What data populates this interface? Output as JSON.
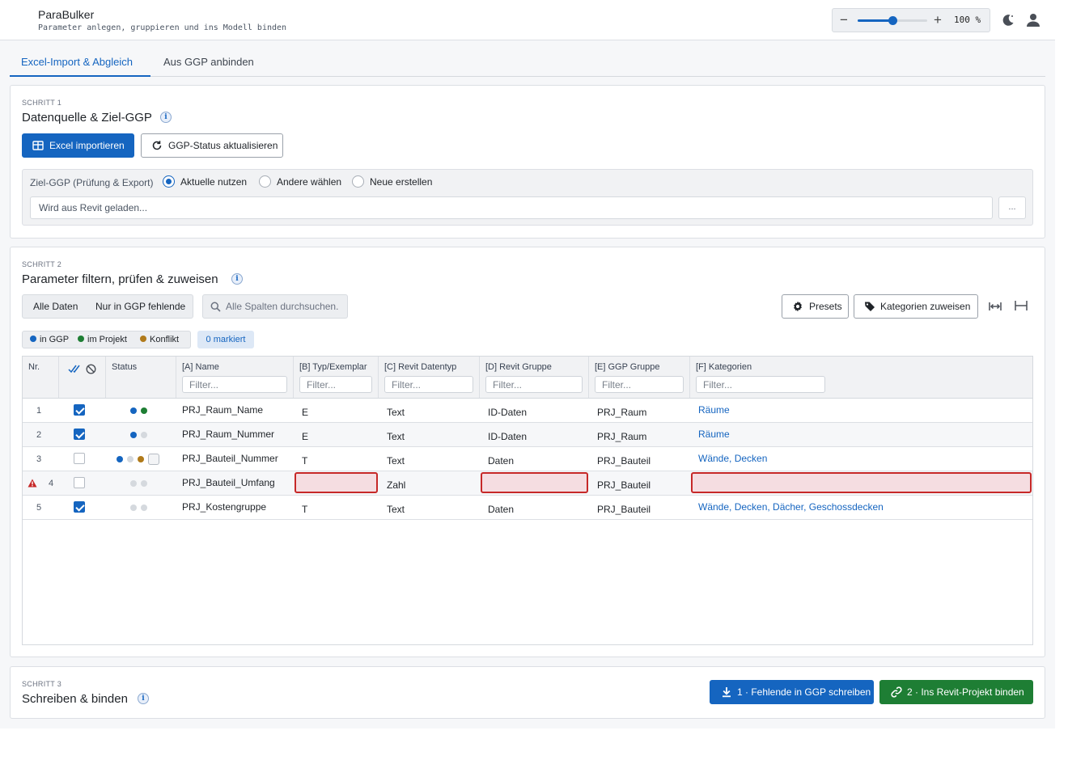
{
  "app": {
    "title": "ParaBulker",
    "subtitle": "Parameter anlegen, gruppieren und ins Modell binden",
    "zoom_label": "100 %",
    "zoom_level_percent": 100,
    "icons": {
      "theme": "moon-icon",
      "user": "user-icon"
    }
  },
  "tabs": [
    {
      "label": "Excel-Import & Abgleich",
      "active": true
    },
    {
      "label": "Aus GGP anbinden",
      "active": false
    }
  ],
  "step1": {
    "label": "SCHRITT 1",
    "title": "Datenquelle & Ziel-GGP",
    "import_button": "Excel importieren",
    "refresh_button": "GGP-Status aktualisieren",
    "target_label": "Ziel-GGP (Prüfung & Export)",
    "radio_options": [
      "Aktuelle nutzen",
      "Andere wählen",
      "Neue erstellen"
    ],
    "selected_option": "Aktuelle nutzen",
    "path_placeholder": "Wird aus Revit geladen...",
    "browse_button": "..."
  },
  "step2": {
    "label": "SCHRITT 2",
    "title": "Parameter filtern, prüfen & zuweisen",
    "filter_all": "Alle Daten",
    "filter_missing": "Nur in GGP fehlende",
    "search_placeholder": "Alle Spalten durchsuchen.",
    "presets_button": "Presets",
    "assign_button": "Kategorien zuweisen",
    "legend": [
      {
        "label": "in GGP",
        "color": "#1565c0"
      },
      {
        "label": "im Projekt",
        "color": "#1e7e34"
      },
      {
        "label": "Konflikt",
        "color": "#b07a1a"
      }
    ],
    "marked_label": "0 markiert",
    "filter_placeholder": "Filter...",
    "columns": [
      "Nr.",
      "Status",
      "[A] Name",
      "[B] Typ/Exemplar",
      "[C] Revit Datentyp",
      "[D] Revit Gruppe",
      "[E] GGP Gruppe",
      "[F] Kategorien"
    ],
    "rows": [
      {
        "nr": "1",
        "checked": true,
        "status": [
          "blue",
          "green"
        ],
        "name": "PRJ_Raum_Name",
        "typ": "E",
        "datentyp": "Text",
        "gruppe": "ID-Daten",
        "ggp_gruppe": "PRJ_Raum",
        "kategorien": "Räume",
        "error": false
      },
      {
        "nr": "2",
        "checked": true,
        "status": [
          "blue",
          "grey"
        ],
        "name": "PRJ_Raum_Nummer",
        "typ": "E",
        "datentyp": "Text",
        "gruppe": "ID-Daten",
        "ggp_gruppe": "PRJ_Raum",
        "kategorien": "Räume",
        "error": false
      },
      {
        "nr": "3",
        "checked": false,
        "status": [
          "blue",
          "grey",
          "orange",
          "box"
        ],
        "name": "PRJ_Bauteil_Nummer",
        "typ": "T",
        "datentyp": "Text",
        "gruppe": "Daten",
        "ggp_gruppe": "PRJ_Bauteil",
        "kategorien": "Wände, Decken",
        "error": false
      },
      {
        "nr": "4",
        "checked": false,
        "status": [
          "grey",
          "grey"
        ],
        "name": "PRJ_Bauteil_Umfang",
        "typ": "",
        "datentyp": "Zahl",
        "gruppe": "",
        "ggp_gruppe": "PRJ_Bauteil",
        "kategorien": "",
        "error": true
      },
      {
        "nr": "5",
        "checked": true,
        "status": [
          "grey",
          "grey"
        ],
        "name": "PRJ_Kostengruppe",
        "typ": "T",
        "datentyp": "Text",
        "gruppe": "Daten",
        "ggp_gruppe": "PRJ_Bauteil",
        "kategorien": "Wände, Decken, Dächer, Geschossdecken",
        "error": false
      }
    ]
  },
  "step3": {
    "label": "SCHRITT 3",
    "title": "Schreiben & binden",
    "write_button": "1 · Fehlende in GGP schreiben",
    "bind_button": "2 · Ins Revit-Projekt binden"
  },
  "colors": {
    "accent": "#1565c0",
    "success": "#1e7e34",
    "conflict": "#b07a1a",
    "error": "#c62828",
    "neutral_dot": "#d5d9de"
  }
}
